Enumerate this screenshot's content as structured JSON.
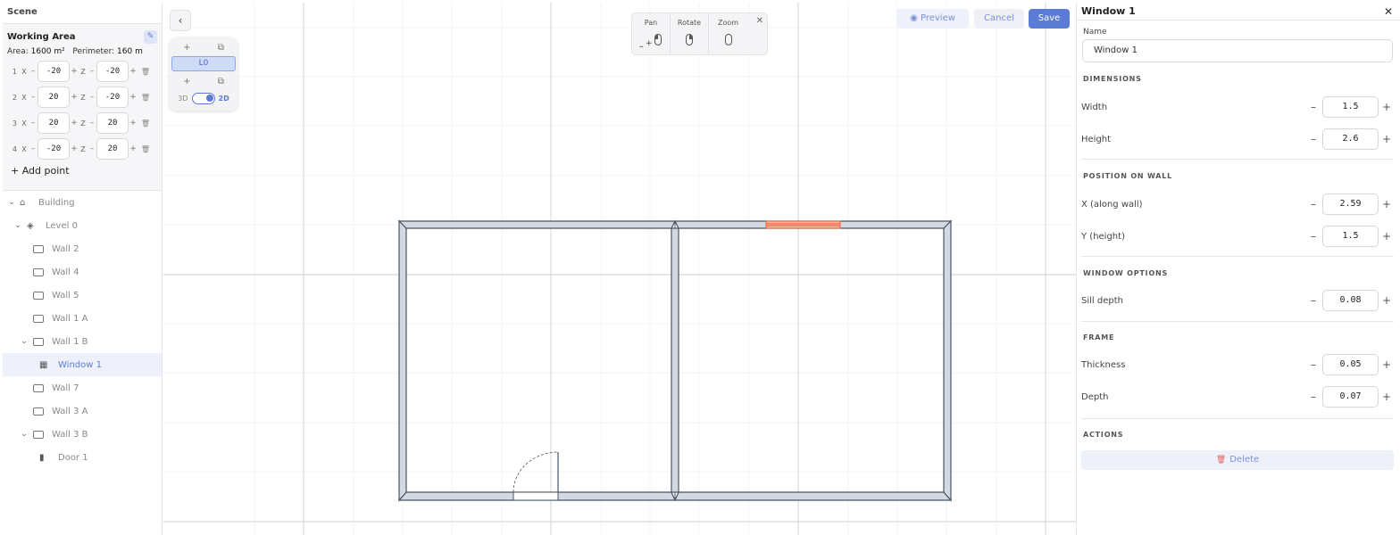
{
  "left": {
    "scene_title": "Scene",
    "working_area": {
      "title": "Working Area",
      "area_label": "Area:",
      "area_value": "1600 m²",
      "perimeter_label": "Perimeter:",
      "perimeter_value": "160 m",
      "points": [
        {
          "index": "1",
          "x": "-20",
          "z": "-20"
        },
        {
          "index": "2",
          "x": "20",
          "z": "-20"
        },
        {
          "index": "3",
          "x": "20",
          "z": "20"
        },
        {
          "index": "4",
          "x": "-20",
          "z": "20"
        }
      ],
      "x_label": "X",
      "z_label": "Z",
      "add_point": "Add point"
    },
    "tree": {
      "building": "Building",
      "level": "Level 0",
      "wall_2": "Wall 2",
      "wall_4": "Wall 4",
      "wall_5": "Wall 5",
      "wall_1a": "Wall 1 A",
      "wall_1b": "Wall 1 B",
      "window_1": "Window 1",
      "wall_7": "Wall 7",
      "wall_3a": "Wall 3 A",
      "wall_3b": "Wall 3 B",
      "door_1": "Door 1"
    }
  },
  "canvas": {
    "level_label": "L0",
    "toggle_3d": "3D",
    "toggle_2d": "2D",
    "hint": {
      "pan": "Pan",
      "rotate": "Rotate",
      "zoom": "Zoom"
    },
    "buttons": {
      "preview": "Preview",
      "cancel": "Cancel",
      "save": "Save"
    },
    "colors": {
      "accent": "#5b7bd5",
      "window": "#e8623a",
      "wall_fill": "#d3d9e0",
      "wall_stroke": "#4a5563"
    }
  },
  "right": {
    "title": "Window 1",
    "name_label": "Name",
    "name_value": "Window 1",
    "dimensions": {
      "title": "DIMENSIONS",
      "width_label": "Width",
      "width_value": "1.5",
      "height_label": "Height",
      "height_value": "2.6"
    },
    "position": {
      "title": "POSITION ON WALL",
      "x_label": "X (along wall)",
      "x_value": "2.59",
      "y_label": "Y (height)",
      "y_value": "1.5"
    },
    "window_options": {
      "title": "WINDOW OPTIONS",
      "sill_label": "Sill depth",
      "sill_value": "0.08"
    },
    "frame": {
      "title": "FRAME",
      "thickness_label": "Thickness",
      "thickness_value": "0.05",
      "depth_label": "Depth",
      "depth_value": "0.07"
    },
    "actions": {
      "title": "ACTIONS",
      "delete": "Delete"
    }
  }
}
